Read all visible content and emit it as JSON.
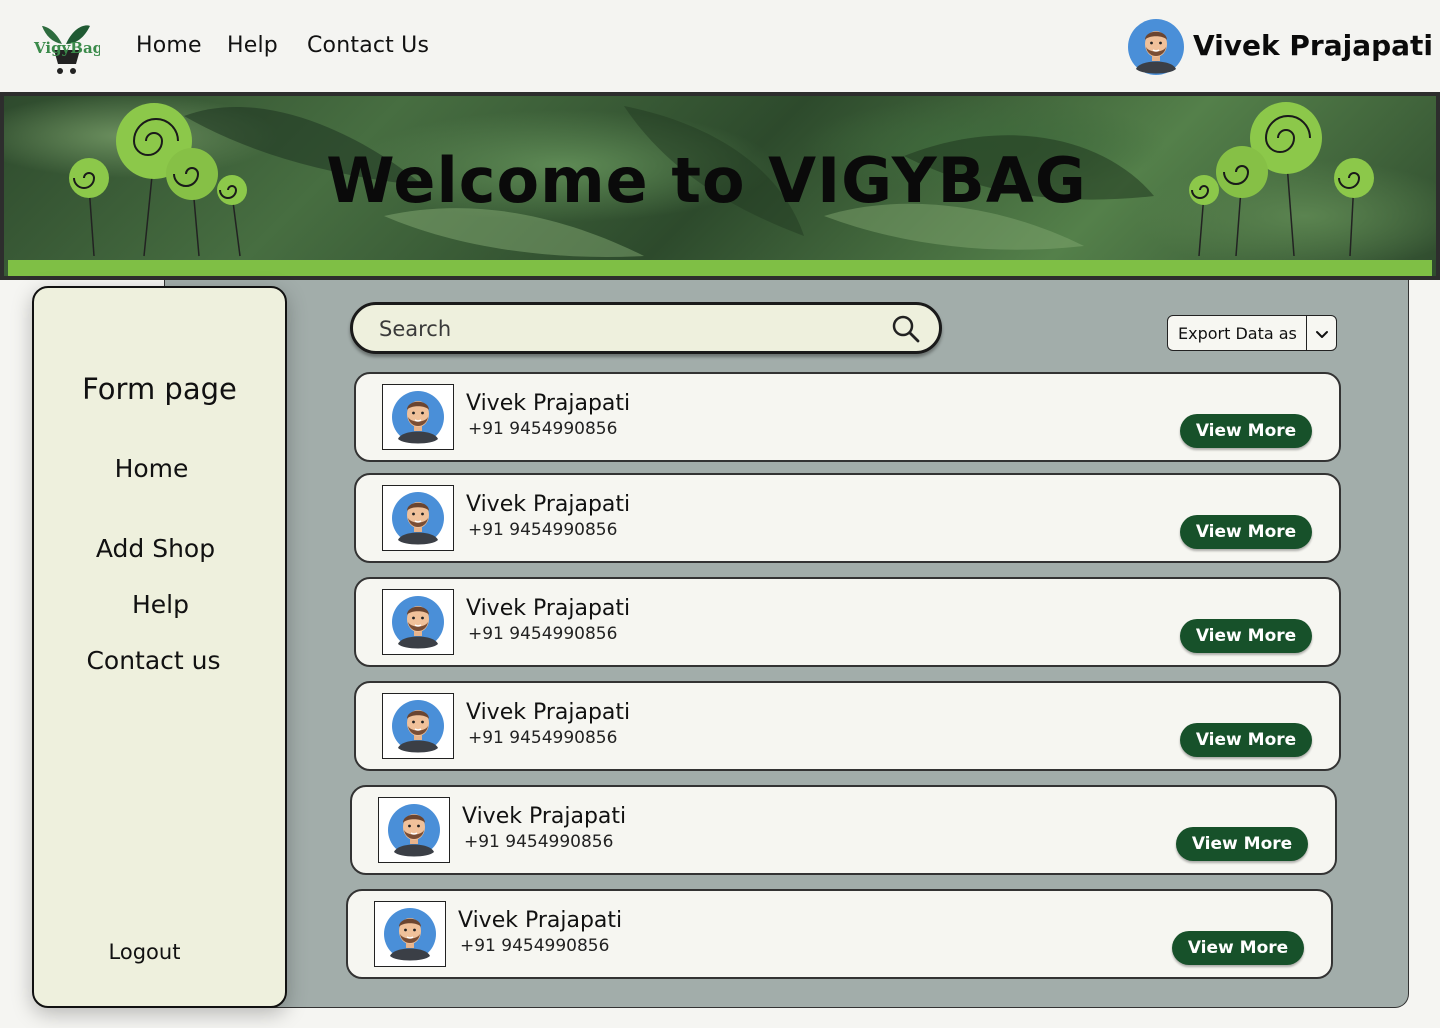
{
  "brand": {
    "logo_text": "VigyBag"
  },
  "topnav": {
    "links": [
      "Home",
      "Help",
      "Contact Us"
    ],
    "user_name": "Vivek Prajapati"
  },
  "banner": {
    "title": "Welcome to VIGYBAG"
  },
  "sidebar": {
    "items": [
      "Form page",
      "Home",
      "Add Shop",
      "Help",
      "Contact us"
    ],
    "logout": "Logout"
  },
  "search": {
    "placeholder": "Search"
  },
  "export": {
    "label": "Export Data as"
  },
  "contacts": [
    {
      "name": "Vivek Prajapati",
      "phone": "+91 9454990856",
      "button": "View More"
    },
    {
      "name": "Vivek Prajapati",
      "phone": "+91 9454990856",
      "button": "View More"
    },
    {
      "name": "Vivek Prajapati",
      "phone": "+91 9454990856",
      "button": "View More"
    },
    {
      "name": "Vivek Prajapati",
      "phone": "+91 9454990856",
      "button": "View More"
    },
    {
      "name": "Vivek Prajapati",
      "phone": "+91 9454990856",
      "button": "View More"
    },
    {
      "name": "Vivek Prajapati",
      "phone": "+91 9454990856",
      "button": "View More"
    }
  ],
  "colors": {
    "accent_green": "#17512a",
    "panel_gray": "#a2adaa",
    "sidebar_bg": "#eef0dd",
    "grass": "#7fbf45"
  },
  "icons": [
    "logo-icon",
    "user-avatar-icon",
    "search-icon",
    "chevron-down-icon",
    "contact-avatar-icon"
  ]
}
